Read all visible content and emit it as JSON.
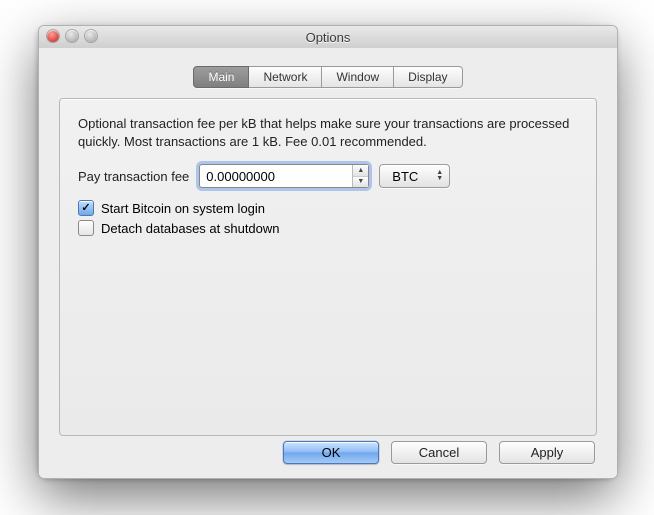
{
  "window": {
    "title": "Options"
  },
  "tabs": [
    "Main",
    "Network",
    "Window",
    "Display"
  ],
  "main": {
    "help_text": "Optional transaction fee per kB that helps make sure your transactions are processed quickly. Most transactions are 1 kB. Fee 0.01 recommended.",
    "fee_label": "Pay transaction fee",
    "fee_value": "0.00000000",
    "fee_unit": "BTC",
    "checkbox1": "Start Bitcoin on system login",
    "checkbox1_checked": true,
    "checkbox2": "Detach databases at shutdown",
    "checkbox2_checked": false
  },
  "buttons": {
    "ok": "OK",
    "cancel": "Cancel",
    "apply": "Apply"
  }
}
